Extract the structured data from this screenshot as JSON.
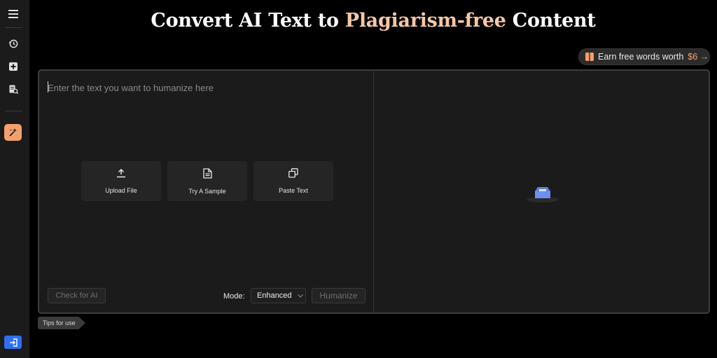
{
  "hero": {
    "title_before": "Convert AI Text to",
    "title_accent": "Plagiarism-free",
    "title_after": "Content"
  },
  "promo": {
    "label": "Earn free words worth",
    "amount": "$6",
    "arrow": "→"
  },
  "editor": {
    "placeholder": "Enter the text you want to humanize here",
    "actions": [
      {
        "label": "Upload File",
        "icon": "upload-icon"
      },
      {
        "label": "Try A Sample",
        "icon": "document-icon"
      },
      {
        "label": "Paste Text",
        "icon": "paste-icon"
      }
    ],
    "check_button": "Check for AI",
    "mode_label": "Mode:",
    "mode_value": "Enhanced",
    "humanize_button": "Humanize"
  },
  "tips": {
    "label": "Tips for use"
  },
  "sidebar": {
    "icons": [
      "menu-icon",
      "history-icon",
      "add-icon",
      "doc-search-icon",
      "magic-wand-icon",
      "login-icon"
    ]
  },
  "colors": {
    "accent": "#f4c8a4",
    "brand_orange": "#f4a06e",
    "brand_blue": "#2f6ff0",
    "illustration_blue": "#5b7fe6"
  }
}
